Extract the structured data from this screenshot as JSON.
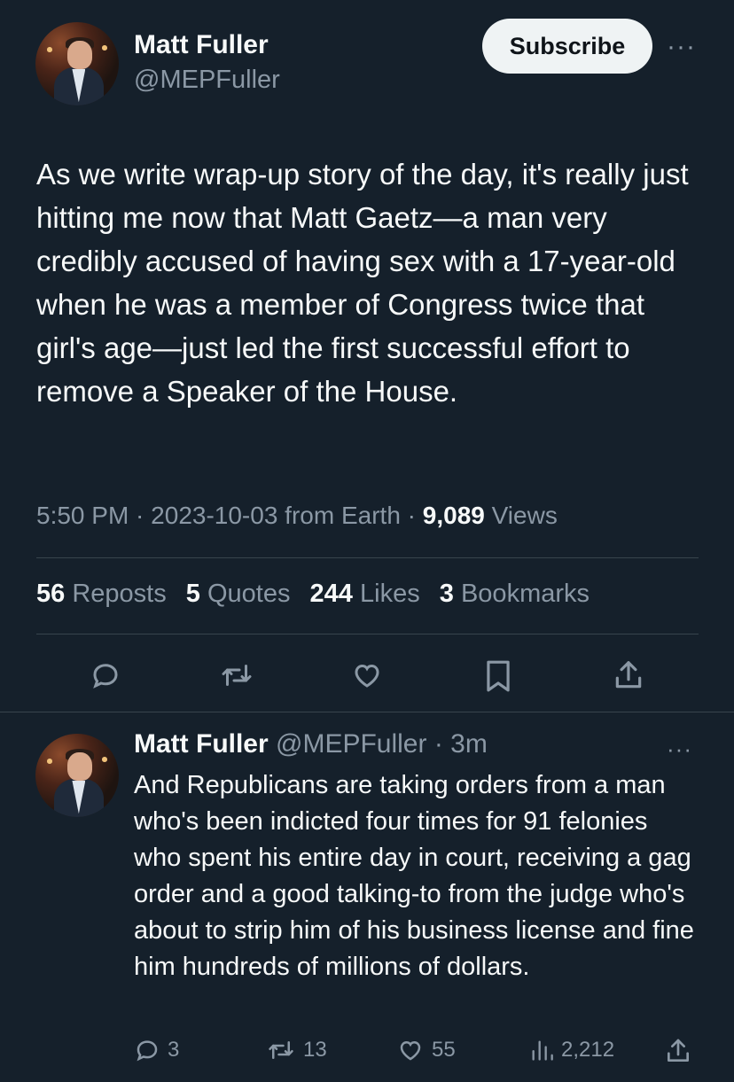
{
  "tweet": {
    "author_name": "Matt Fuller",
    "author_handle": "@MEPFuller",
    "subscribe_label": "Subscribe",
    "more_label": "···",
    "text": "As we write wrap-up story of the day, it's really just hitting me now that Matt Gaetz—a man very credibly accused of having sex with a 17-year-old when he was a member of Congress twice that girl's age—just led the first successful effort to remove a Speaker of the House.",
    "time": "5:50 PM",
    "sep1": " · ",
    "date": "2023-10-03",
    "source": " from Earth",
    "sep2": " · ",
    "views_count": "9,089",
    "views_label": " Views",
    "stats": {
      "reposts_count": "56",
      "reposts_label": " Reposts",
      "quotes_count": "5",
      "quotes_label": " Quotes",
      "likes_count": "244",
      "likes_label": " Likes",
      "bookmarks_count": "3",
      "bookmarks_label": " Bookmarks"
    },
    "actions": [
      "reply-icon",
      "repost-icon",
      "like-icon",
      "bookmark-icon",
      "share-icon"
    ]
  },
  "reply": {
    "author_name": "Matt Fuller",
    "author_handle": " @MEPFuller",
    "time_sep": " · ",
    "time": "3m",
    "more_label": "···",
    "text": "And Republicans are taking orders from a man who's been indicted four times for 91 felonies who spent his entire day in court, receiving a gag order and a good talking-to from the judge who's about to strip him of his business license and fine him hundreds of millions of dollars.",
    "replies": "3",
    "reposts": "13",
    "likes": "55",
    "views": "2,212"
  },
  "colors": {
    "background": "#15202b",
    "text": "#f7f9f9",
    "secondary": "#8b98a5",
    "divider": "#38444d",
    "button_bg": "#eff3f4"
  }
}
